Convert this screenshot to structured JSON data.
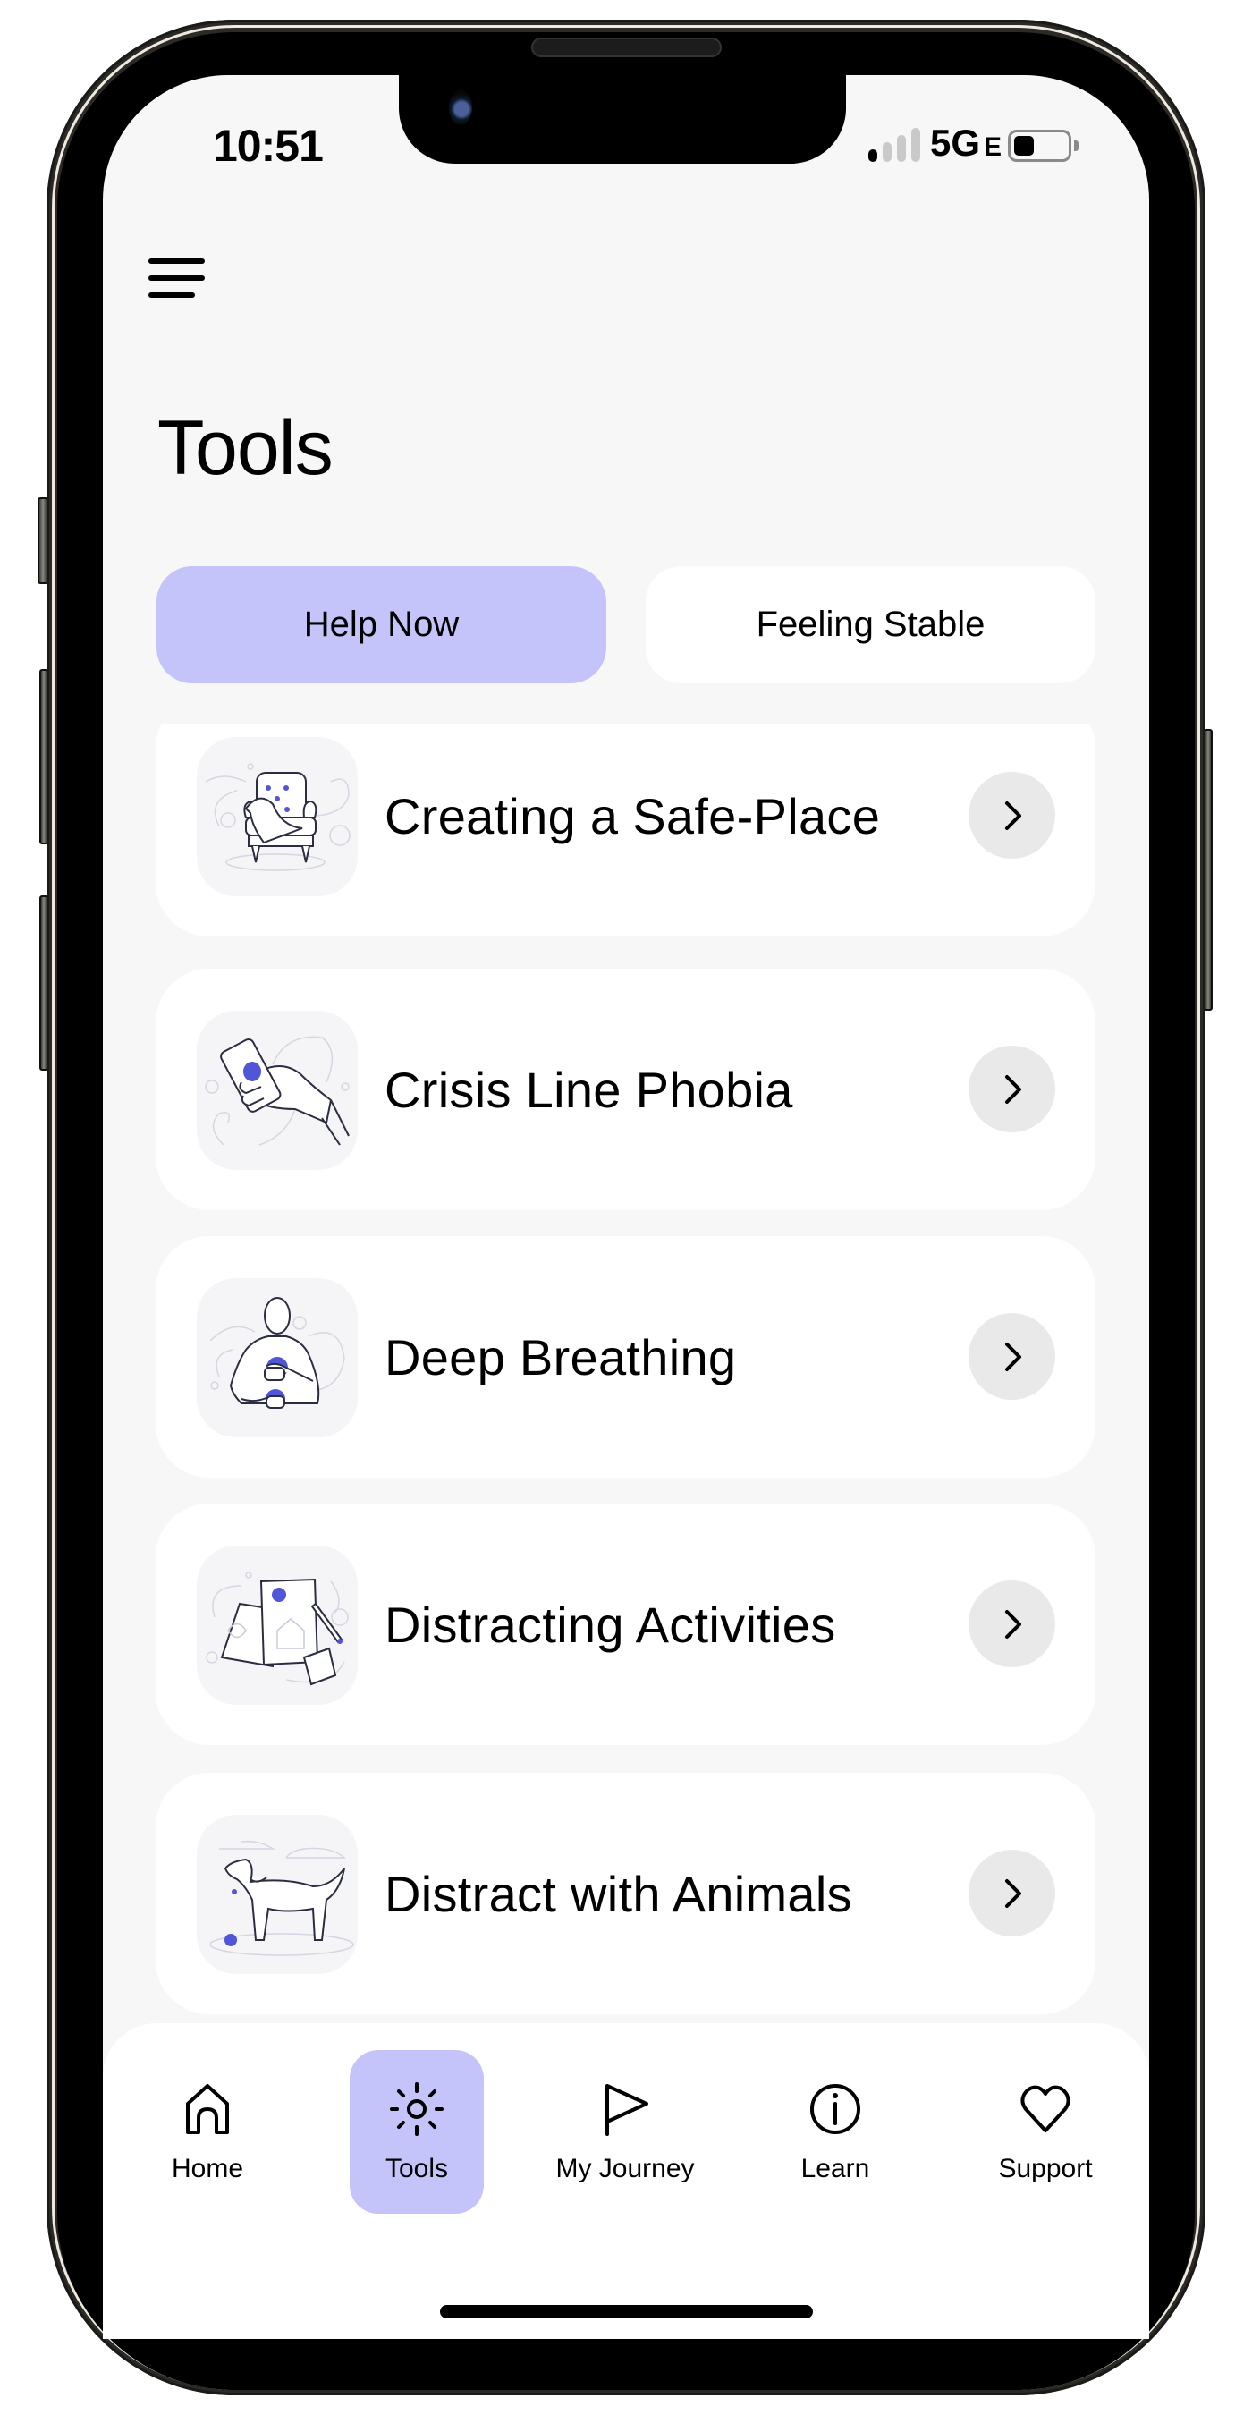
{
  "status_bar": {
    "time": "10:51",
    "network": "5G",
    "network_suffix": "E",
    "signal_bars_filled": 1,
    "signal_bars_total": 4
  },
  "header": {
    "menu_icon": "hamburger-menu-icon",
    "title": "Tools"
  },
  "tabs": [
    {
      "label": "Help Now",
      "active": true
    },
    {
      "label": "Feeling Stable",
      "active": false
    }
  ],
  "tools": [
    {
      "title": "Creating a Safe-Place",
      "icon": "armchair-illustration"
    },
    {
      "title": "Crisis Line Phobia",
      "icon": "hand-holding-phone-illustration"
    },
    {
      "title": "Deep Breathing",
      "icon": "person-breathing-illustration"
    },
    {
      "title": "Distracting Activities",
      "icon": "drawing-paper-pencil-illustration"
    },
    {
      "title": "Distract with Animals",
      "icon": "dog-illustration"
    }
  ],
  "bottom_nav": [
    {
      "label": "Home",
      "icon": "home-icon",
      "active": false
    },
    {
      "label": "Tools",
      "icon": "sun-icon",
      "active": true
    },
    {
      "label": "My Journey",
      "icon": "flag-icon",
      "active": false
    },
    {
      "label": "Learn",
      "icon": "info-icon",
      "active": false
    },
    {
      "label": "Support",
      "icon": "heart-icon",
      "active": false
    }
  ],
  "colors": {
    "accent": "#c4c4fa",
    "background": "#f7f7f7",
    "card": "#ffffff",
    "arrow_button": "#e9e9e9",
    "illustration_accent": "#5056d6"
  }
}
